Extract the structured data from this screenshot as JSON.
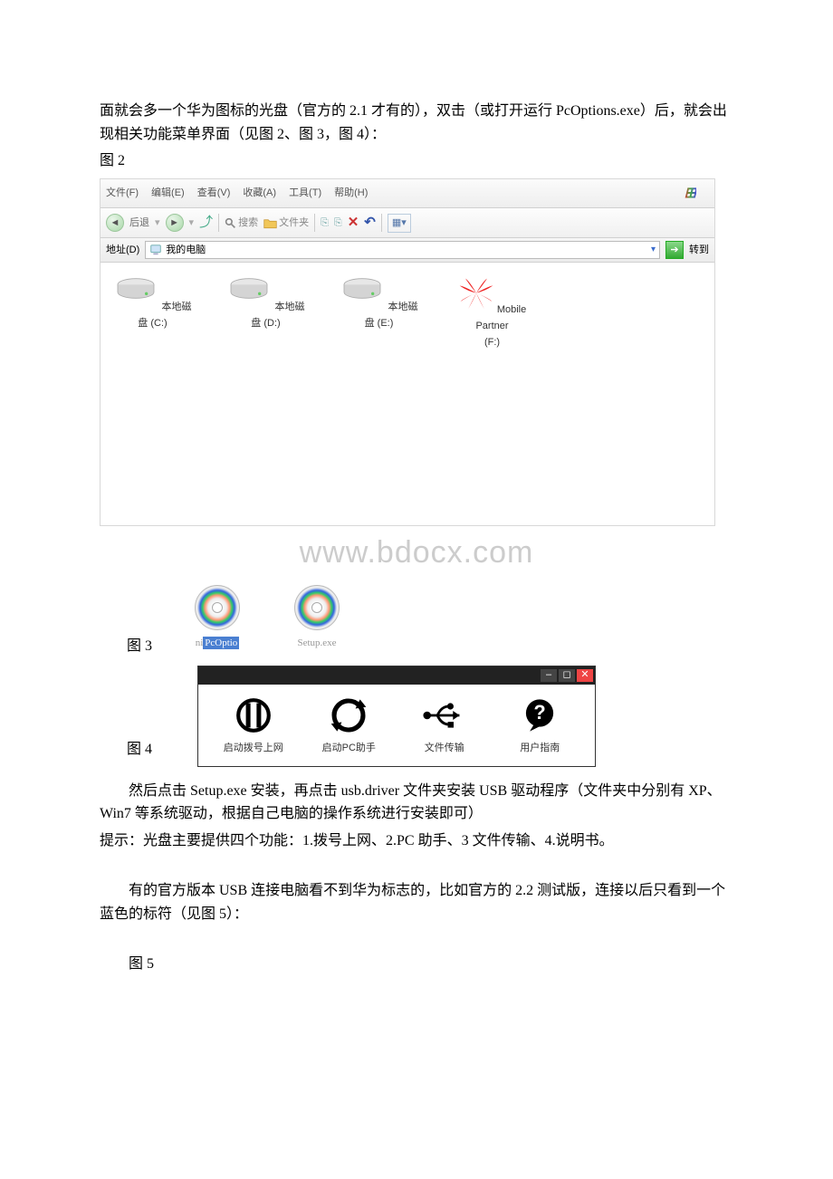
{
  "body": {
    "intro": "面就会多一个华为图标的光盘（官方的 2.1 才有的），双击（或打开运行 PcOptions.exe）后，就会出现相关功能菜单界面（见图 2、图 3，图 4）：",
    "fig2_label": "图 2",
    "fig3_label": "图 3",
    "fig4_label": "图 4",
    "para_after4_1": "然后点击 Setup.exe 安装，再点击 usb.driver 文件夹安装 USB 驱动程序（文件夹中分别有 XP、Win7 等系统驱动，根据自己电脑的操作系统进行安装即可）",
    "para_after4_2": "提示：光盘主要提供四个功能：1.拨号上网、2.PC 助手、3 文件传输、4.说明书。",
    "para_after4_3": "有的官方版本 USB 连接电脑看不到华为标志的，比如官方的 2.2 测试版，连接以后只看到一个蓝色的标符（见图 5）：",
    "fig5_label": "图 5"
  },
  "watermark": "www.bdocx.com",
  "explorer": {
    "menu": {
      "file": "文件(F)",
      "edit": "编辑(E)",
      "view": "查看(V)",
      "fav": "收藏(A)",
      "tools": "工具(T)",
      "help": "帮助(H)"
    },
    "toolbar": {
      "back": "后退",
      "search": "搜索",
      "folders": "文件夹"
    },
    "address": {
      "label": "地址(D)",
      "value": "我的电脑",
      "go": "转到"
    },
    "drives": {
      "c": "本地磁盘 (C:)",
      "d": "本地磁盘 (D:)",
      "e": "本地磁盘 (E:)",
      "f1": "Mobile Partner",
      "f2": "(F:)"
    }
  },
  "fig3": {
    "item1_pre": "ni",
    "item1_sel": "PcOptio",
    "item2": "Setup.exe"
  },
  "fig4": {
    "item1": "启动拨号上网",
    "item2": "启动PC助手",
    "item3": "文件传输",
    "item4": "用户指南"
  }
}
